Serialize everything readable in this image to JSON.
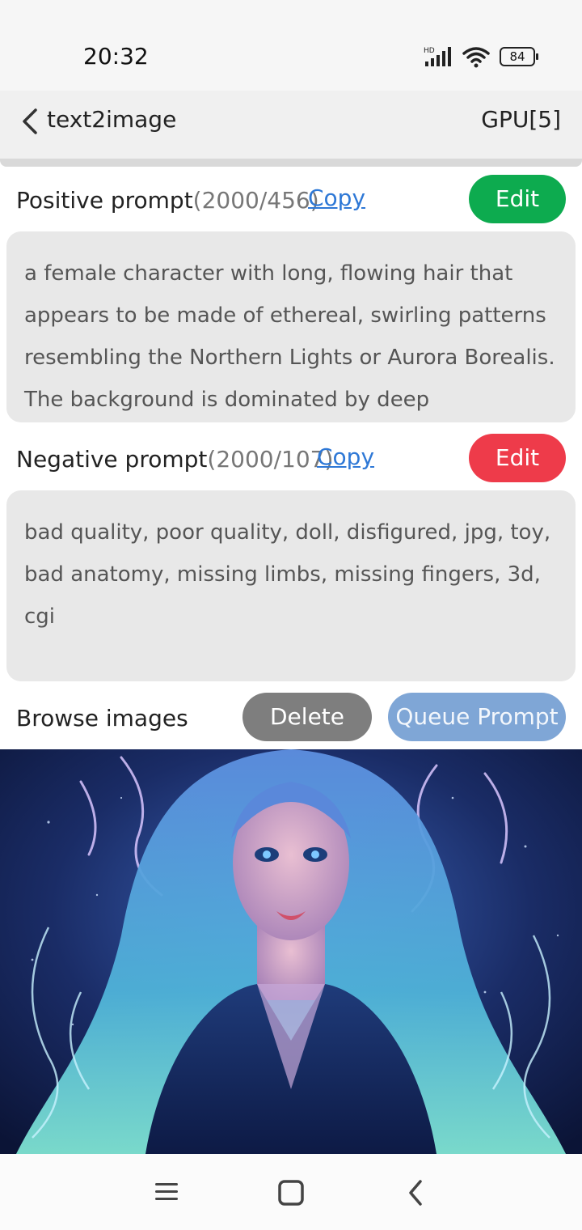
{
  "status_bar": {
    "time": "20:32",
    "network_label": "HD",
    "battery": "84"
  },
  "app_bar": {
    "title": "text2image",
    "gpu": "GPU[5]"
  },
  "positive": {
    "label": "Positive prompt",
    "count": "(2000/456)",
    "copy": "Copy",
    "edit": "Edit",
    "text": "a female character with long, flowing hair that appears to be made of ethereal, swirling patterns resembling the Northern Lights or Aurora Borealis. The background is dominated by deep"
  },
  "negative": {
    "label": "Negative prompt",
    "count": "(2000/107)",
    "copy": "Copy",
    "edit": "Edit",
    "text": "bad quality, poor quality, doll, disfigured, jpg, toy, bad anatomy, missing limbs, missing fingers, 3d, cgi"
  },
  "images": {
    "label": "Browse images",
    "delete": "Delete",
    "queue": "Queue Prompt"
  },
  "colors": {
    "accent_green": "#0dab4f",
    "accent_red": "#ee3b4a",
    "link_blue": "#2e78d6",
    "queue_blue": "#7fa6d6"
  },
  "nav": {
    "icons": [
      "menu-icon",
      "home-square-icon",
      "back-arrow-icon"
    ]
  }
}
